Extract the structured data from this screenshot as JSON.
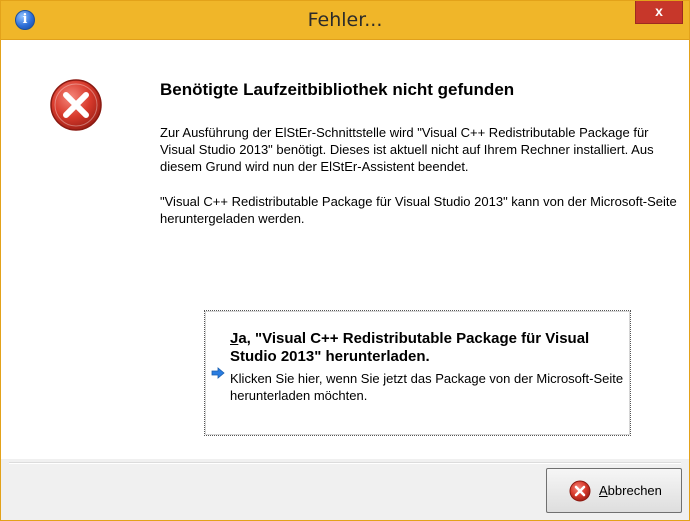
{
  "window": {
    "title": "Fehler...",
    "close_glyph": "x",
    "title_icon": "info-icon"
  },
  "message": {
    "icon": "error-icon",
    "heading": "Benötigte Laufzeitbibliothek nicht gefunden",
    "paragraph1": "Zur Ausführung der ElStEr-Schnittstelle wird \"Visual C++ Redistributable Package für Visual Studio 2013\" benötigt. Dieses ist aktuell nicht auf Ihrem Rechner installiert. Aus diesem Grund wird nun der ElStEr-Assistent beendet.",
    "paragraph2": "\"Visual C++ Redistributable Package für Visual Studio 2013\" kann von der Microsoft-Seite heruntergeladen werden."
  },
  "command_link": {
    "mnemonic": "J",
    "title_rest": "a, \"Visual C++ Redistributable Package für Visual Studio 2013\" herunterladen.",
    "description": "Klicken Sie hier, wenn Sie jetzt das Package von der Microsoft-Seite herunterladen möchten."
  },
  "footer": {
    "cancel_mnemonic": "A",
    "cancel_rest": "bbrechen"
  },
  "colors": {
    "titlebar": "#f0b629",
    "close_button": "#c7372a",
    "error_red": "#d83a2c",
    "arrow_blue": "#2a7de1"
  }
}
